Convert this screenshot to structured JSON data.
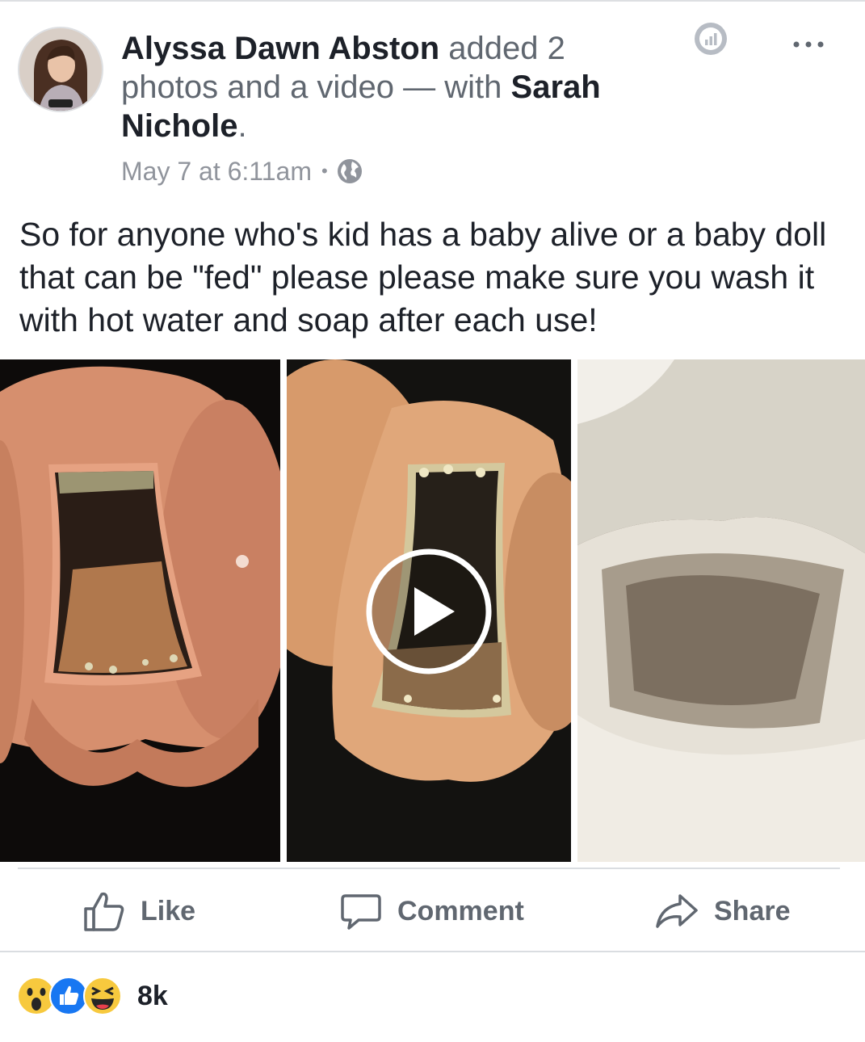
{
  "post": {
    "author": "Alyssa Dawn Abston",
    "action_text": " added 2 photos and a video — with ",
    "tagged": "Sarah Nichole",
    "punct": ".",
    "timestamp": "May 7 at 6:11am",
    "separator": "•",
    "privacy_icon": "globe-icon",
    "body": "So for anyone who's kid has a baby alive or a baby doll that can be \"fed\" please please make sure you wash it with hot water and soap after each use!",
    "media": [
      {
        "kind": "photo"
      },
      {
        "kind": "video"
      },
      {
        "kind": "photo"
      }
    ]
  },
  "actions": {
    "like": "Like",
    "comment": "Comment",
    "share": "Share"
  },
  "reactions": {
    "icons": [
      "wow-emoji",
      "like-emoji",
      "haha-emoji"
    ],
    "count": "8k"
  },
  "colors": {
    "text": "#1d2129",
    "secondary": "#606770",
    "muted": "#90949c",
    "like_blue": "#1877f2",
    "divider": "#dadde1"
  }
}
